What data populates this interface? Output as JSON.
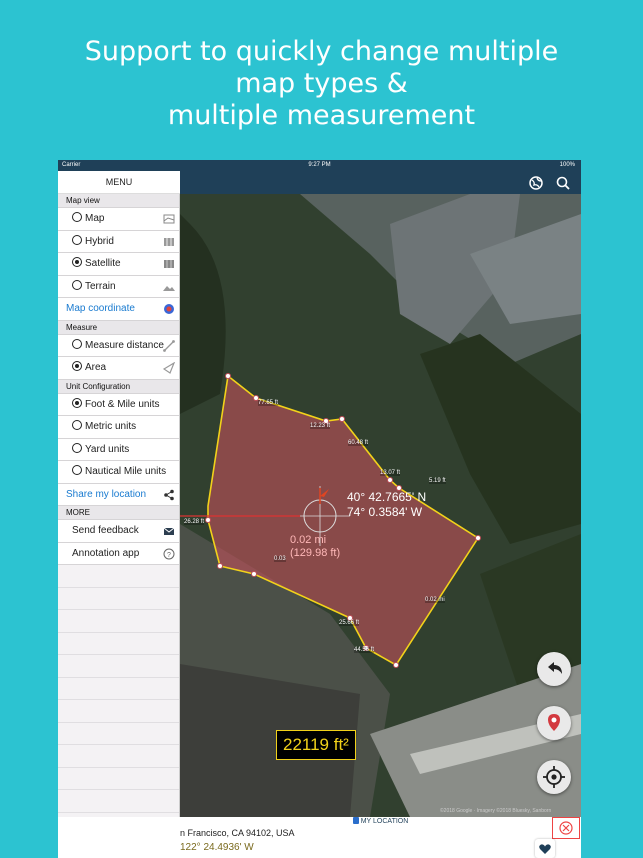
{
  "headline": {
    "line1": "Support to quickly change multiple",
    "line2": "map types &",
    "line3": "multiple measurement"
  },
  "statusbar": {
    "carrier": "Carrier",
    "time": "9:27 PM",
    "battery": "100%"
  },
  "menu": {
    "title": "MENU",
    "map_view_header": "Map view",
    "map_types": [
      {
        "label": "Map",
        "selected": false
      },
      {
        "label": "Hybrid",
        "selected": false
      },
      {
        "label": "Satellite",
        "selected": true
      },
      {
        "label": "Terrain",
        "selected": false
      }
    ],
    "map_coordinate": "Map coordinate",
    "measure_header": "Measure",
    "measure_modes": [
      {
        "label": "Measure distance",
        "selected": false
      },
      {
        "label": "Area",
        "selected": true
      }
    ],
    "unit_header": "Unit Configuration",
    "units": [
      {
        "label": "Foot & Mile units",
        "selected": true
      },
      {
        "label": "Metric units",
        "selected": false
      },
      {
        "label": "Yard units",
        "selected": false
      },
      {
        "label": "Nautical Mile units",
        "selected": false
      }
    ],
    "share_location": "Share my location",
    "more_header": "MORE",
    "send_feedback": "Send feedback",
    "annotation_app": "Annotation app"
  },
  "map": {
    "edge_labels": [
      "77.65 ft",
      "12.23 ft",
      "60.48 ft",
      "13.07 ft",
      "5.19 ft",
      "26.28 ft",
      "0.03",
      "0.02 mi",
      "25.66 ft",
      "44.56 ft"
    ],
    "coord_lat": "40° 42.7665' N",
    "coord_lon": "74° 0.3584' W",
    "dist_mi": "0.02 mi",
    "dist_ft": "(129.98 ft)",
    "area": "22119 ft²",
    "attribution": "©2018 Google · Imagery ©2018 Bluesky, Sanborn",
    "colors": {
      "polygon_fill": "#c0505a",
      "polygon_stroke": "#f2d21a",
      "accent": "#2cc3d1"
    }
  },
  "bottom": {
    "my_location_label": "MY LOCATION",
    "address": "n Francisco, CA 94102, USA",
    "coords": "122° 24.4936' W"
  }
}
